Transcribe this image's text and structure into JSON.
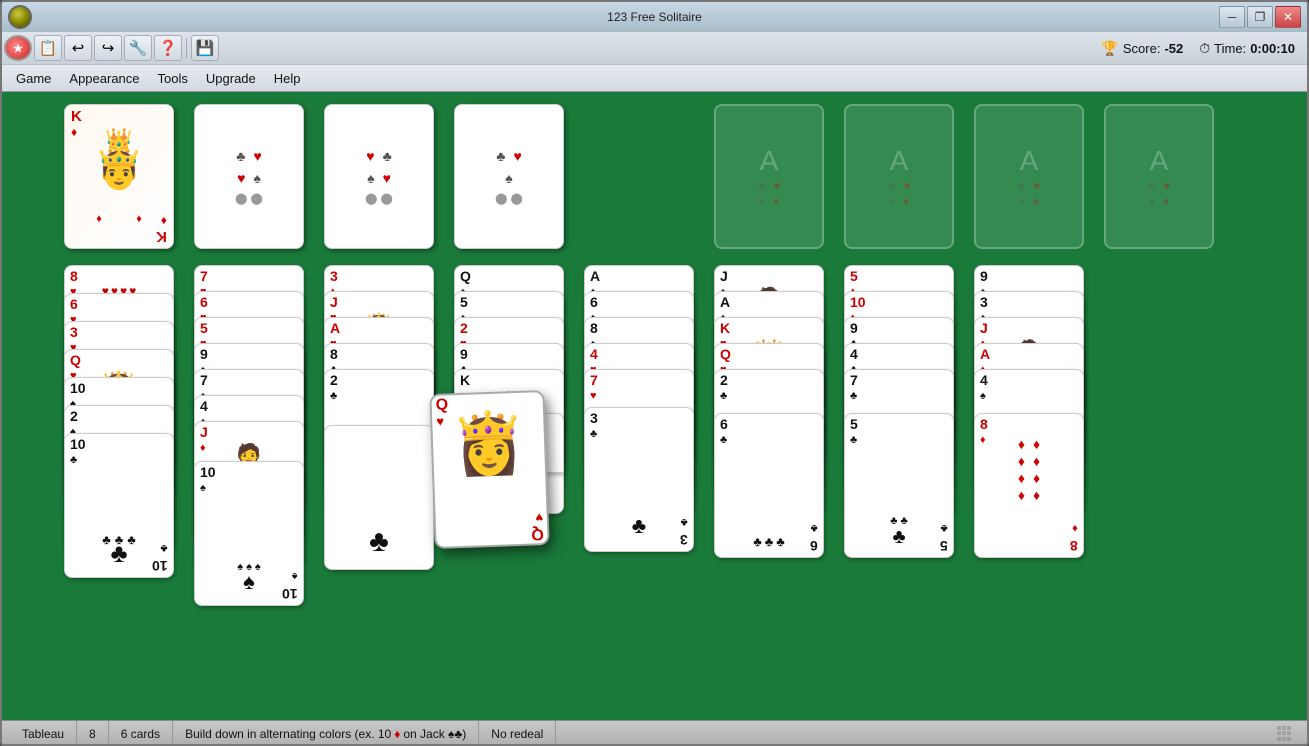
{
  "window": {
    "title": "123 Free Solitaire"
  },
  "toolbar": {
    "icons": [
      "🔴",
      "📄",
      "↩",
      "↪",
      "🔧",
      "❓",
      "💾"
    ]
  },
  "menu": {
    "items": [
      "Game",
      "Appearance",
      "Tools",
      "Upgrade",
      "Help"
    ]
  },
  "score": {
    "label": "Score:",
    "value": "-52",
    "time_label": "Time:",
    "time_value": "0:00:10"
  },
  "statusbar": {
    "game_type": "Tableau",
    "columns": "8",
    "cards": "6 cards",
    "rule": "Build down in alternating colors (ex. 10 ♦ on Jack ♠♣)",
    "redeal": "No redeal"
  },
  "winbtns": {
    "minimize": "─",
    "restore": "❐",
    "close": "✕"
  }
}
